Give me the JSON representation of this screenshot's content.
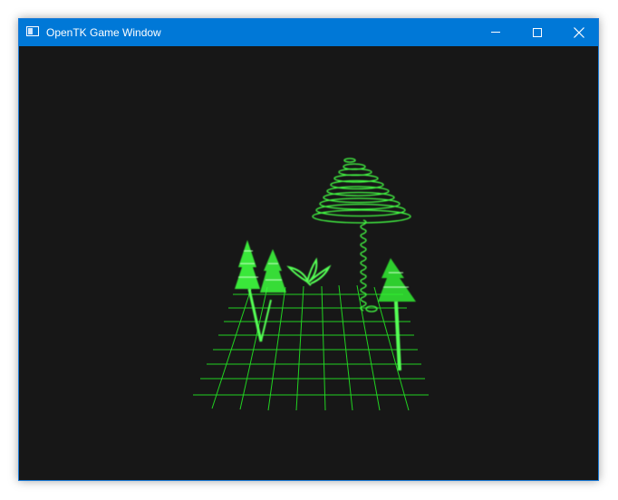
{
  "window": {
    "title": "OpenTK Game Window",
    "icon": "app-window-icon",
    "controls": {
      "minimize": "minimize-icon",
      "maximize": "maximize-icon",
      "close": "close-icon"
    }
  },
  "scene": {
    "background": "#171717",
    "wireframe_color": "#33ff33",
    "objects": [
      "grid-floor",
      "tree",
      "tree",
      "sprout",
      "mushroom",
      "tree"
    ]
  }
}
